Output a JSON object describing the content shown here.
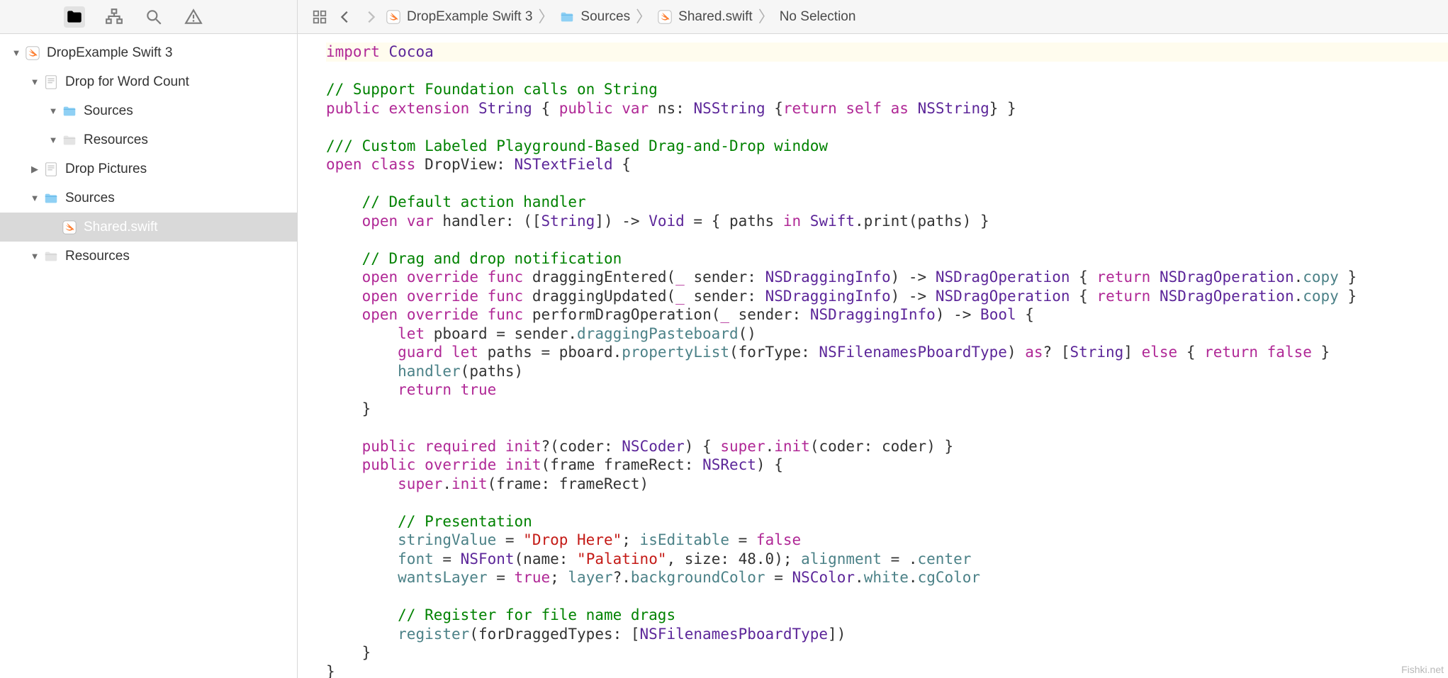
{
  "breadcrumb": {
    "items": [
      {
        "label": "DropExample Swift 3",
        "icon": "swift"
      },
      {
        "label": "Sources",
        "icon": "folder-blue"
      },
      {
        "label": "Shared.swift",
        "icon": "swift"
      },
      {
        "label": "No Selection",
        "icon": ""
      }
    ]
  },
  "tree": [
    {
      "indent": 0,
      "disclosure": "down",
      "icon": "swift-doc",
      "label": "DropExample Swift 3",
      "selected": false
    },
    {
      "indent": 1,
      "disclosure": "down",
      "icon": "page",
      "label": "Drop for Word Count",
      "selected": false
    },
    {
      "indent": 2,
      "disclosure": "down",
      "icon": "folder-blue",
      "label": "Sources",
      "selected": false
    },
    {
      "indent": 2,
      "disclosure": "down",
      "icon": "folder-gray",
      "label": "Resources",
      "selected": false
    },
    {
      "indent": 1,
      "disclosure": "right",
      "icon": "page",
      "label": "Drop Pictures",
      "selected": false
    },
    {
      "indent": 1,
      "disclosure": "down",
      "icon": "folder-blue",
      "label": "Sources",
      "selected": false
    },
    {
      "indent": 2,
      "disclosure": "",
      "icon": "swift-doc",
      "label": "Shared.swift",
      "selected": true
    },
    {
      "indent": 1,
      "disclosure": "down",
      "icon": "folder-gray",
      "label": "Resources",
      "selected": false
    }
  ],
  "code_lines": [
    {
      "cls": "hl",
      "tokens": [
        [
          "kw",
          "import"
        ],
        [
          "plain",
          " "
        ],
        [
          "typ",
          "Cocoa"
        ]
      ]
    },
    {
      "tokens": []
    },
    {
      "tokens": [
        [
          "cmt",
          "// Support Foundation calls on String"
        ]
      ]
    },
    {
      "tokens": [
        [
          "kw",
          "public"
        ],
        [
          "plain",
          " "
        ],
        [
          "kw",
          "extension"
        ],
        [
          "plain",
          " "
        ],
        [
          "typ",
          "String"
        ],
        [
          "plain",
          " { "
        ],
        [
          "kw",
          "public"
        ],
        [
          "plain",
          " "
        ],
        [
          "kw",
          "var"
        ],
        [
          "plain",
          " ns: "
        ],
        [
          "typ",
          "NSString"
        ],
        [
          "plain",
          " {"
        ],
        [
          "kw",
          "return"
        ],
        [
          "plain",
          " "
        ],
        [
          "kw",
          "self"
        ],
        [
          "plain",
          " "
        ],
        [
          "kw",
          "as"
        ],
        [
          "plain",
          " "
        ],
        [
          "typ",
          "NSString"
        ],
        [
          "plain",
          "} }"
        ]
      ]
    },
    {
      "tokens": []
    },
    {
      "tokens": [
        [
          "doc",
          "/// Custom Labeled Playground-Based Drag-and-Drop window"
        ]
      ]
    },
    {
      "tokens": [
        [
          "kw",
          "open"
        ],
        [
          "plain",
          " "
        ],
        [
          "kw",
          "class"
        ],
        [
          "plain",
          " DropView: "
        ],
        [
          "typ",
          "NSTextField"
        ],
        [
          "plain",
          " {"
        ]
      ]
    },
    {
      "tokens": []
    },
    {
      "tokens": [
        [
          "plain",
          "    "
        ],
        [
          "cmt",
          "// Default action handler"
        ]
      ]
    },
    {
      "tokens": [
        [
          "plain",
          "    "
        ],
        [
          "kw",
          "open"
        ],
        [
          "plain",
          " "
        ],
        [
          "kw",
          "var"
        ],
        [
          "plain",
          " handler: (["
        ],
        [
          "typ",
          "String"
        ],
        [
          "plain",
          "]) -> "
        ],
        [
          "typ",
          "Void"
        ],
        [
          "plain",
          " = { paths "
        ],
        [
          "kw",
          "in"
        ],
        [
          "plain",
          " "
        ],
        [
          "typ",
          "Swift"
        ],
        [
          "plain",
          ".print(paths) }"
        ]
      ]
    },
    {
      "tokens": []
    },
    {
      "tokens": [
        [
          "plain",
          "    "
        ],
        [
          "cmt",
          "// Drag and drop notification"
        ]
      ]
    },
    {
      "tokens": [
        [
          "plain",
          "    "
        ],
        [
          "kw",
          "open"
        ],
        [
          "plain",
          " "
        ],
        [
          "kw",
          "override"
        ],
        [
          "plain",
          " "
        ],
        [
          "kw",
          "func"
        ],
        [
          "plain",
          " draggingEntered("
        ],
        [
          "kw",
          "_"
        ],
        [
          "plain",
          " sender: "
        ],
        [
          "typ",
          "NSDraggingInfo"
        ],
        [
          "plain",
          ") -> "
        ],
        [
          "typ",
          "NSDragOperation"
        ],
        [
          "plain",
          " { "
        ],
        [
          "kw",
          "return"
        ],
        [
          "plain",
          " "
        ],
        [
          "typ",
          "NSDragOperation"
        ],
        [
          "plain",
          "."
        ],
        [
          "mem",
          "copy"
        ],
        [
          "plain",
          " }"
        ]
      ]
    },
    {
      "tokens": [
        [
          "plain",
          "    "
        ],
        [
          "kw",
          "open"
        ],
        [
          "plain",
          " "
        ],
        [
          "kw",
          "override"
        ],
        [
          "plain",
          " "
        ],
        [
          "kw",
          "func"
        ],
        [
          "plain",
          " draggingUpdated("
        ],
        [
          "kw",
          "_"
        ],
        [
          "plain",
          " sender: "
        ],
        [
          "typ",
          "NSDraggingInfo"
        ],
        [
          "plain",
          ") -> "
        ],
        [
          "typ",
          "NSDragOperation"
        ],
        [
          "plain",
          " { "
        ],
        [
          "kw",
          "return"
        ],
        [
          "plain",
          " "
        ],
        [
          "typ",
          "NSDragOperation"
        ],
        [
          "plain",
          "."
        ],
        [
          "mem",
          "copy"
        ],
        [
          "plain",
          " }"
        ]
      ]
    },
    {
      "tokens": [
        [
          "plain",
          "    "
        ],
        [
          "kw",
          "open"
        ],
        [
          "plain",
          " "
        ],
        [
          "kw",
          "override"
        ],
        [
          "plain",
          " "
        ],
        [
          "kw",
          "func"
        ],
        [
          "plain",
          " performDragOperation("
        ],
        [
          "kw",
          "_"
        ],
        [
          "plain",
          " sender: "
        ],
        [
          "typ",
          "NSDraggingInfo"
        ],
        [
          "plain",
          ") -> "
        ],
        [
          "typ",
          "Bool"
        ],
        [
          "plain",
          " {"
        ]
      ]
    },
    {
      "tokens": [
        [
          "plain",
          "        "
        ],
        [
          "kw",
          "let"
        ],
        [
          "plain",
          " pboard = sender."
        ],
        [
          "mem",
          "draggingPasteboard"
        ],
        [
          "plain",
          "()"
        ]
      ]
    },
    {
      "tokens": [
        [
          "plain",
          "        "
        ],
        [
          "kw",
          "guard"
        ],
        [
          "plain",
          " "
        ],
        [
          "kw",
          "let"
        ],
        [
          "plain",
          " paths = pboard."
        ],
        [
          "mem",
          "propertyList"
        ],
        [
          "plain",
          "(forType: "
        ],
        [
          "typ",
          "NSFilenamesPboardType"
        ],
        [
          "plain",
          ") "
        ],
        [
          "kw",
          "as"
        ],
        [
          "plain",
          "? ["
        ],
        [
          "typ",
          "String"
        ],
        [
          "plain",
          "] "
        ],
        [
          "kw",
          "else"
        ],
        [
          "plain",
          " { "
        ],
        [
          "kw",
          "return"
        ],
        [
          "plain",
          " "
        ],
        [
          "kw",
          "false"
        ],
        [
          "plain",
          " }"
        ]
      ]
    },
    {
      "tokens": [
        [
          "plain",
          "        "
        ],
        [
          "mem",
          "handler"
        ],
        [
          "plain",
          "(paths)"
        ]
      ]
    },
    {
      "tokens": [
        [
          "plain",
          "        "
        ],
        [
          "kw",
          "return"
        ],
        [
          "plain",
          " "
        ],
        [
          "kw",
          "true"
        ]
      ]
    },
    {
      "tokens": [
        [
          "plain",
          "    }"
        ]
      ]
    },
    {
      "tokens": []
    },
    {
      "tokens": [
        [
          "plain",
          "    "
        ],
        [
          "kw",
          "public"
        ],
        [
          "plain",
          " "
        ],
        [
          "kw",
          "required"
        ],
        [
          "plain",
          " "
        ],
        [
          "kw",
          "init"
        ],
        [
          "plain",
          "?(coder: "
        ],
        [
          "typ",
          "NSCoder"
        ],
        [
          "plain",
          ") { "
        ],
        [
          "kw",
          "super"
        ],
        [
          "plain",
          "."
        ],
        [
          "kw",
          "init"
        ],
        [
          "plain",
          "(coder: coder) }"
        ]
      ]
    },
    {
      "tokens": [
        [
          "plain",
          "    "
        ],
        [
          "kw",
          "public"
        ],
        [
          "plain",
          " "
        ],
        [
          "kw",
          "override"
        ],
        [
          "plain",
          " "
        ],
        [
          "kw",
          "init"
        ],
        [
          "plain",
          "(frame frameRect: "
        ],
        [
          "typ",
          "NSRect"
        ],
        [
          "plain",
          ") {"
        ]
      ]
    },
    {
      "tokens": [
        [
          "plain",
          "        "
        ],
        [
          "kw",
          "super"
        ],
        [
          "plain",
          "."
        ],
        [
          "kw",
          "init"
        ],
        [
          "plain",
          "(frame: frameRect)"
        ]
      ]
    },
    {
      "tokens": []
    },
    {
      "tokens": [
        [
          "plain",
          "        "
        ],
        [
          "cmt",
          "// Presentation"
        ]
      ]
    },
    {
      "tokens": [
        [
          "plain",
          "        "
        ],
        [
          "mem",
          "stringValue"
        ],
        [
          "plain",
          " = "
        ],
        [
          "str",
          "\"Drop Here\""
        ],
        [
          "plain",
          "; "
        ],
        [
          "mem",
          "isEditable"
        ],
        [
          "plain",
          " = "
        ],
        [
          "kw",
          "false"
        ]
      ]
    },
    {
      "tokens": [
        [
          "plain",
          "        "
        ],
        [
          "mem",
          "font"
        ],
        [
          "plain",
          " = "
        ],
        [
          "typ",
          "NSFont"
        ],
        [
          "plain",
          "(name: "
        ],
        [
          "str",
          "\"Palatino\""
        ],
        [
          "plain",
          ", size: 48.0); "
        ],
        [
          "mem",
          "alignment"
        ],
        [
          "plain",
          " = ."
        ],
        [
          "mem",
          "center"
        ]
      ]
    },
    {
      "tokens": [
        [
          "plain",
          "        "
        ],
        [
          "mem",
          "wantsLayer"
        ],
        [
          "plain",
          " = "
        ],
        [
          "kw",
          "true"
        ],
        [
          "plain",
          "; "
        ],
        [
          "mem",
          "layer"
        ],
        [
          "plain",
          "?."
        ],
        [
          "mem",
          "backgroundColor"
        ],
        [
          "plain",
          " = "
        ],
        [
          "typ",
          "NSColor"
        ],
        [
          "plain",
          "."
        ],
        [
          "mem",
          "white"
        ],
        [
          "plain",
          "."
        ],
        [
          "mem",
          "cgColor"
        ]
      ]
    },
    {
      "tokens": []
    },
    {
      "tokens": [
        [
          "plain",
          "        "
        ],
        [
          "cmt",
          "// Register for file name drags"
        ]
      ]
    },
    {
      "tokens": [
        [
          "plain",
          "        "
        ],
        [
          "mem",
          "register"
        ],
        [
          "plain",
          "(forDraggedTypes: ["
        ],
        [
          "typ",
          "NSFilenamesPboardType"
        ],
        [
          "plain",
          "])"
        ]
      ]
    },
    {
      "tokens": [
        [
          "plain",
          "    }"
        ]
      ]
    },
    {
      "tokens": [
        [
          "plain",
          "}"
        ]
      ]
    }
  ],
  "watermark": "Fishki.net"
}
